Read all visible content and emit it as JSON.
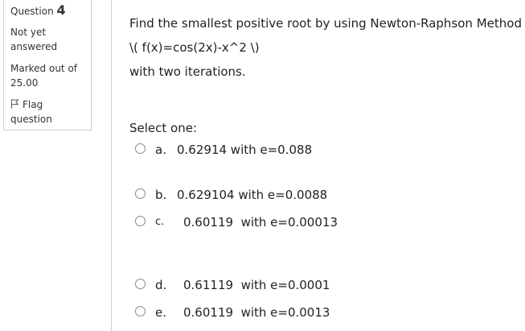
{
  "info": {
    "question_label": "Question",
    "question_number": "4",
    "state": "Not yet answered",
    "grade": "Marked out of 25.00",
    "flag_icon": "flag-icon",
    "flag_label": "Flag question"
  },
  "question": {
    "line1": "Find the smallest positive root by using Newton-Raphson Method",
    "line2": "\\( f(x)=cos(2x)-x^2 \\)",
    "line3": "with two iterations."
  },
  "prompt": "Select one:",
  "options": [
    {
      "letter": "a.",
      "text": "0.62914 with e=0.088"
    },
    {
      "letter": "b.",
      "text": "0.629104 with e=0.0088"
    },
    {
      "letter": "c.",
      "text": "0.60119  with e=0.00013"
    },
    {
      "letter": "d.",
      "text": "0.61119  with e=0.0001"
    },
    {
      "letter": "e.",
      "text": "0.60119  with e=0.0013"
    }
  ]
}
